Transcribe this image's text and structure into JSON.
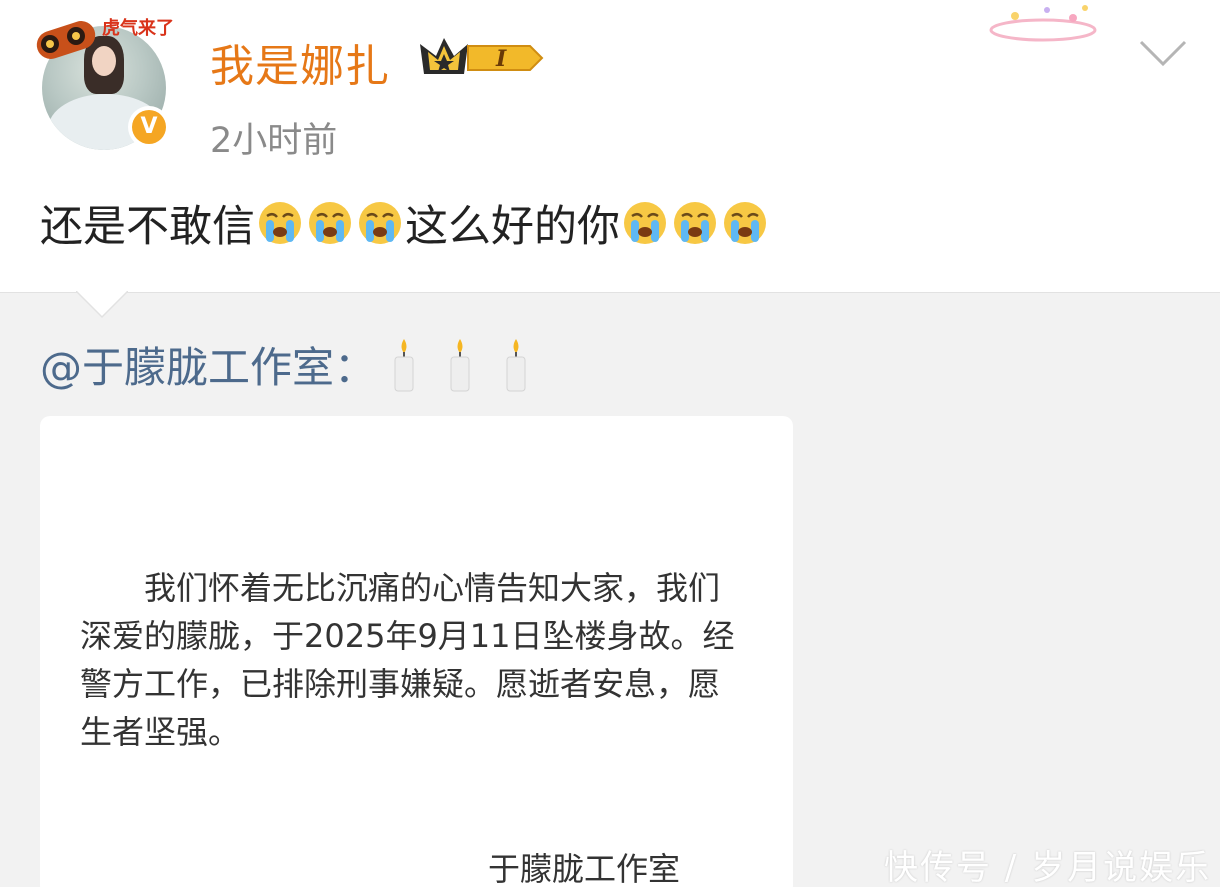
{
  "post": {
    "username": "我是娜扎",
    "frame_text": "虎气来了",
    "verified_mark": "V",
    "member_level": "I",
    "timestamp": "2小时前",
    "text_part1": "还是不敢信",
    "text_part2": "这么好的你",
    "emoji": "crying-face-icon"
  },
  "repost": {
    "author": "@于朦胧工作室",
    "separator": "：",
    "candle_icon": "candle-icon",
    "statement": "我们怀着无比沉痛的心情告知大家，我们深爱的朦胧，于2025年9月11日坠楼身故。经警方工作，已排除刑事嫌疑。愿逝者安息，愿生者坚强。",
    "signature": "于朦胧工作室"
  },
  "watermark": "快传号 / 岁月说娱乐",
  "colors": {
    "username": "#e67817",
    "mention": "#4d6a8c",
    "timestamp": "#8a8a8a",
    "repost_bg": "#f2f2f2",
    "verified": "#f5a623"
  }
}
